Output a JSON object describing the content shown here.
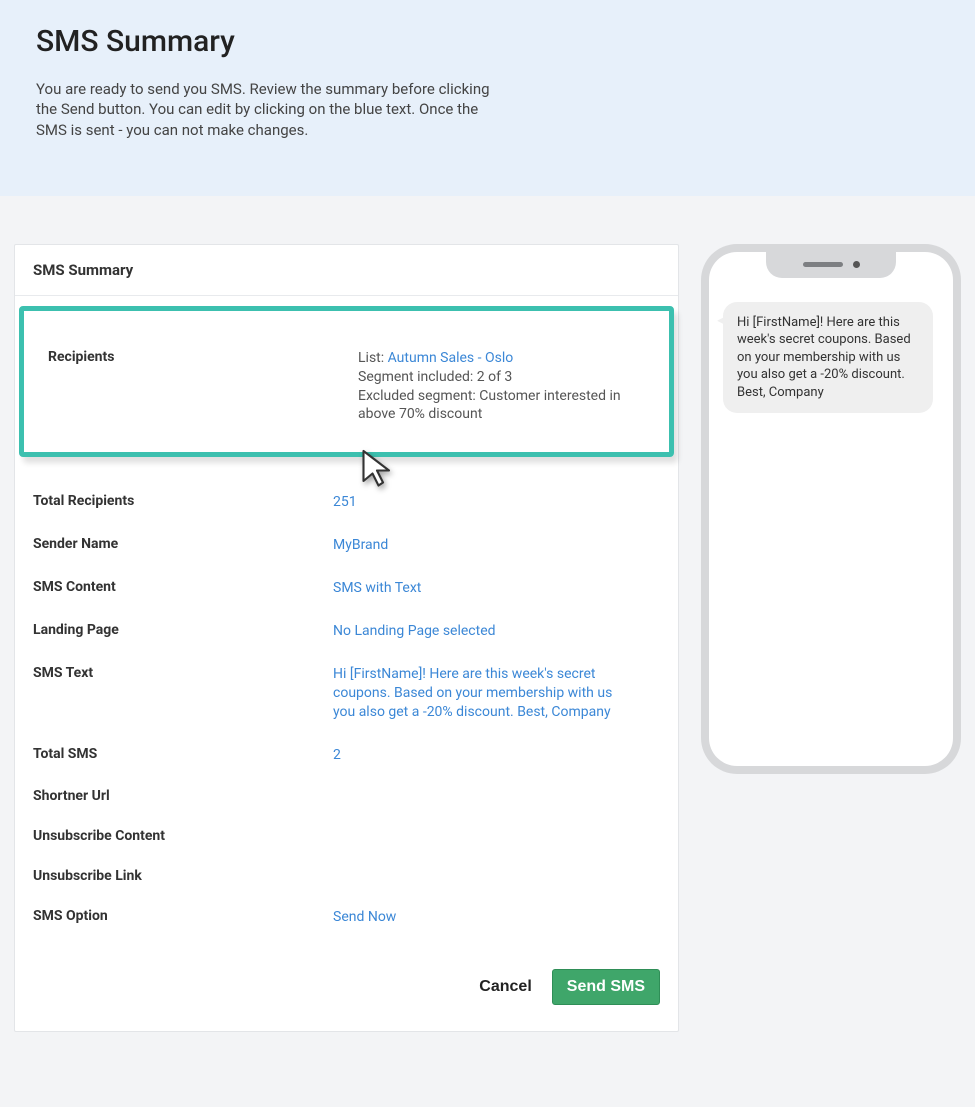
{
  "hero": {
    "title": "SMS Summary",
    "description": "You are ready to send you SMS. Review the summary before clicking the Send button. You can edit by clicking on the blue text. Once the SMS is sent - you can not make changes."
  },
  "card": {
    "title": "SMS Summary"
  },
  "recipients": {
    "label": "Recipients",
    "list_prefix": "List: ",
    "list_link": "Autumn Sales - Oslo",
    "segment_included": "Segment included: 2 of 3",
    "excluded_segment": "Excluded segment:  Customer interested in above 70% discount"
  },
  "rows": {
    "total_recipients": {
      "label": "Total Recipients",
      "value": "251"
    },
    "sender_name": {
      "label": "Sender Name",
      "value": "MyBrand"
    },
    "sms_content": {
      "label": "SMS Content",
      "value": "SMS with Text"
    },
    "landing_page": {
      "label": "Landing Page",
      "value": "No Landing Page selected"
    },
    "sms_text": {
      "label": "SMS Text",
      "value": "Hi [FirstName]! Here are this week's secret coupons. Based on your membership with us you also get a -20% discount. Best, Company"
    },
    "total_sms": {
      "label": "Total SMS",
      "value": "2"
    },
    "shortner_url": {
      "label": "Shortner Url",
      "value": ""
    },
    "unsubscribe_content": {
      "label": "Unsubscribe Content",
      "value": ""
    },
    "unsubscribe_link": {
      "label": "Unsubscribe Link",
      "value": ""
    },
    "sms_option": {
      "label": "SMS Option",
      "value": "Send Now"
    }
  },
  "actions": {
    "cancel": "Cancel",
    "send": "Send SMS"
  },
  "phone": {
    "message": "Hi [FirstName]! Here are this week's secret coupons. Based on your membership with us you also get a -20% discount. Best, Company"
  }
}
